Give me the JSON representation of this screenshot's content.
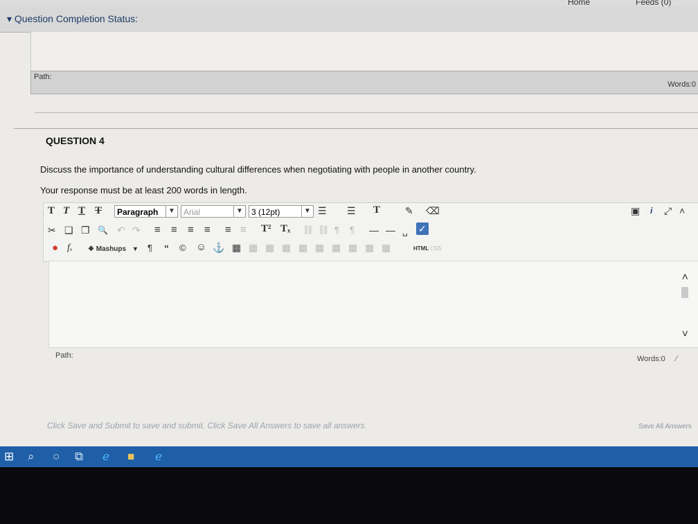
{
  "browser": {
    "home_link": "Home",
    "feeds_link": "Feeds (0)"
  },
  "status": {
    "label": "Question Completion Status:"
  },
  "previous_editor": {
    "path_label": "Path:",
    "words_label": "Words:0"
  },
  "question": {
    "title": "QUESTION 4",
    "text": "Discuss the importance of understanding cultural differences when negotiating with people in another country.",
    "note": "Your response must be at least 200 words in length."
  },
  "toolbar": {
    "row1": {
      "text_btn_1": "T",
      "text_btn_2": "T",
      "text_btn_3": "T",
      "text_btn_4": "T",
      "format_value": "Paragraph",
      "font_value": "Arial",
      "size_value": "3 (12pt)",
      "font_color": "T"
    },
    "row2": {
      "superscript": "T²",
      "subscript": "Tₓ"
    },
    "row3": {
      "mashups_label": "Mashups",
      "html_label": "HTML",
      "css_label": "CSS"
    }
  },
  "editor": {
    "path_label": "Path:",
    "words_label": "Words:0"
  },
  "footer": {
    "instructions": "Click Save and Submit to save and submit. Click Save All Answers to save all answers.",
    "save_all_label": "Save All Answers"
  },
  "icons": {
    "collapse": "▾",
    "cut": "✂",
    "copy": "❑",
    "paste": "❐",
    "find": "🔍",
    "undo": "↶",
    "redo": "↷",
    "align_left": "≡",
    "align_center": "≡",
    "align_right": "≡",
    "justify": "≡",
    "list_bullet": "☰",
    "list_number": "☰",
    "pen": "✎",
    "eraser": "⌫",
    "link": "⛓",
    "hr": "—",
    "spellcheck": "✓",
    "record": "●",
    "formula": "fₓ",
    "paragraph": "¶",
    "quote": "“",
    "copyright": "©",
    "emoji": "☺",
    "anchor": "⚓",
    "table": "▦",
    "preview": "▣",
    "info": "i",
    "fullscreen": "⤢",
    "collapse_toolbar": "˄",
    "scroll_up": "˄",
    "scroll_down": "˅",
    "resize": "∕",
    "windows": "⊞",
    "search": "⌕",
    "cortana": "○",
    "taskview": "⧉",
    "edge": "e",
    "explorer": "■",
    "ie": "e"
  }
}
